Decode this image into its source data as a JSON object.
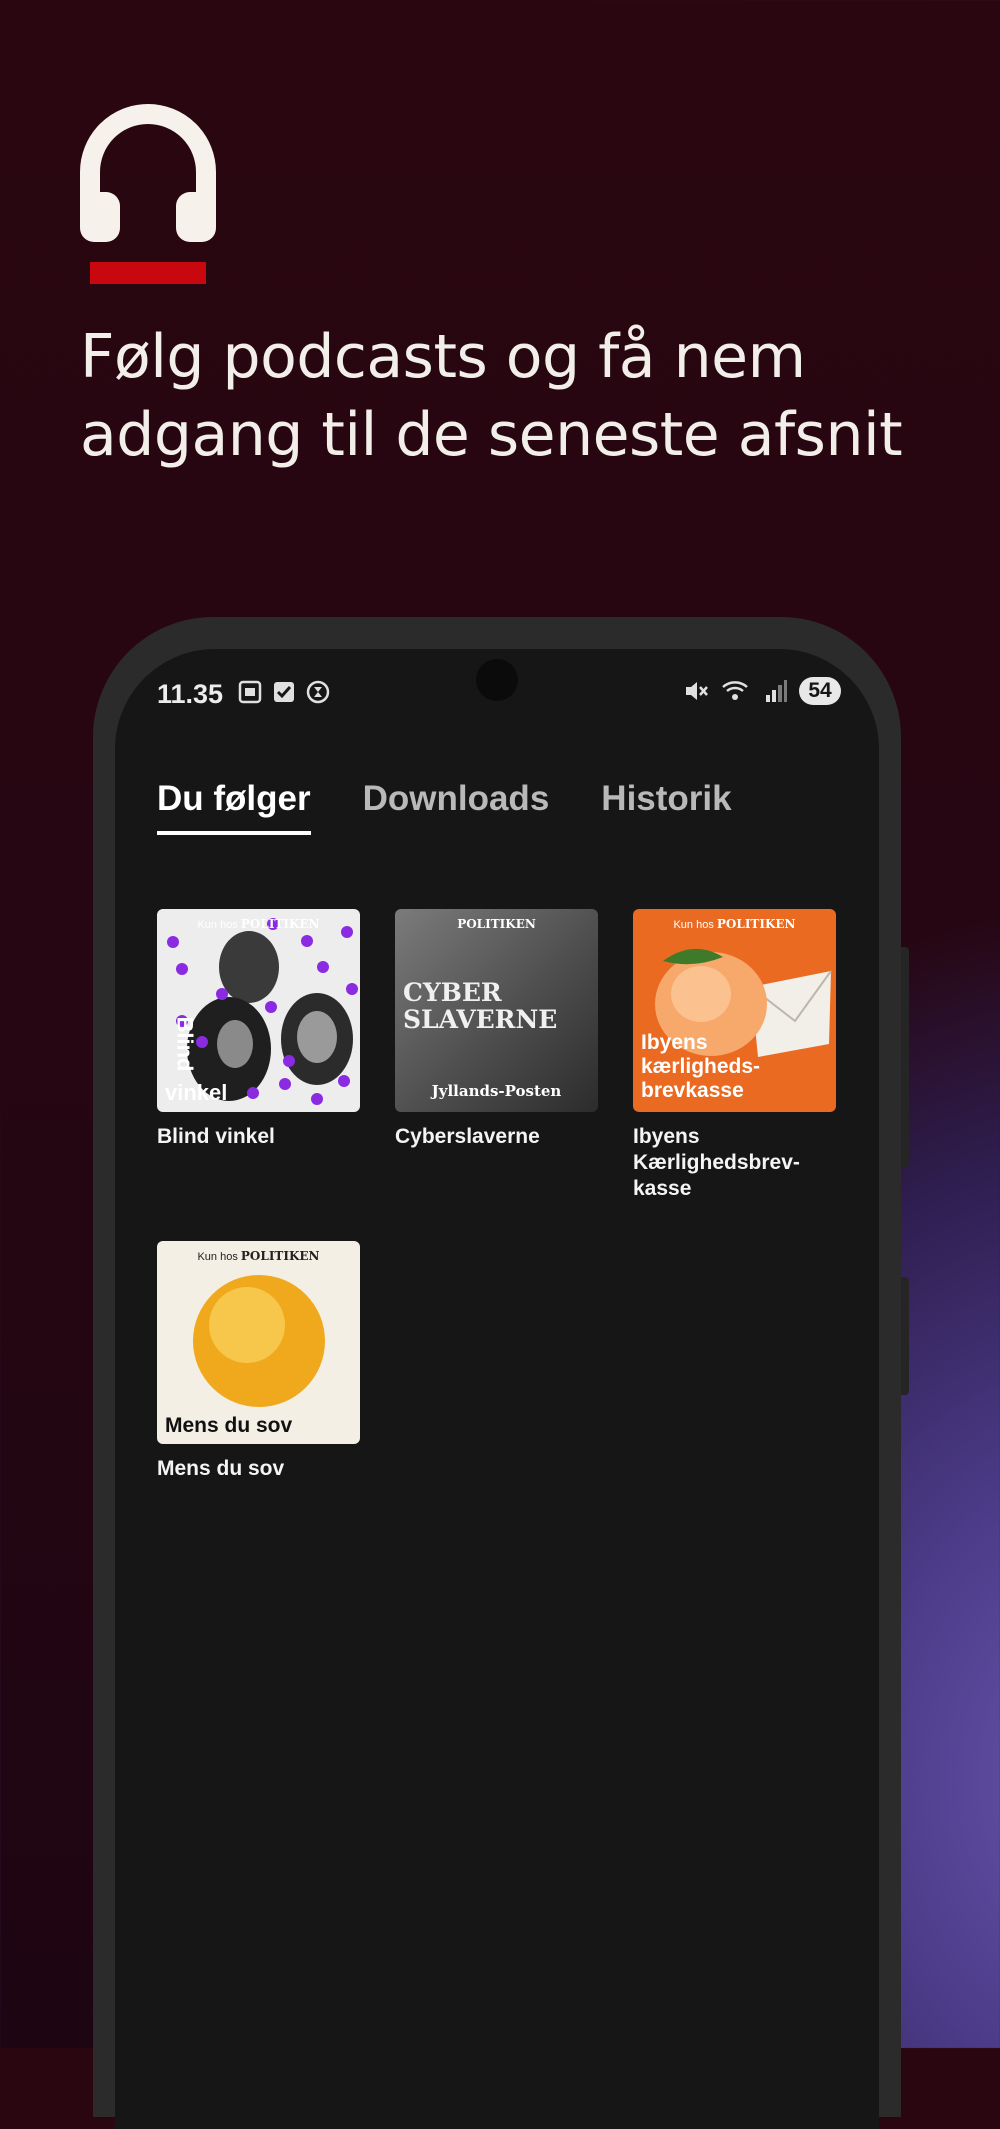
{
  "hero": {
    "title": "Følg podcasts og få nem adgang til de seneste afsnit",
    "icon": "headphones-icon",
    "accent": "#c8070f"
  },
  "status_bar": {
    "time": "11.35",
    "battery": "54"
  },
  "tabs": [
    {
      "label": "Du følger",
      "active": true
    },
    {
      "label": "Downloads",
      "active": false
    },
    {
      "label": "Historik",
      "active": false
    }
  ],
  "podcasts": [
    {
      "label": "Blind vinkel",
      "cover_text": [
        "Kun hos",
        "POLITIKEN",
        "Blind",
        "vinkel"
      ]
    },
    {
      "label": "Cyberslaverne",
      "cover_text": [
        "POLITIKEN",
        "CYBER",
        "SLAVERNE",
        "Jyllands-Posten"
      ]
    },
    {
      "label": "Ibyens Kærlighedsbrev-kasse",
      "label_lines": [
        "Ibyens",
        "Kærlighedsbrev-",
        "kasse"
      ],
      "cover_text": [
        "Kun hos",
        "POLITIKEN",
        "Ibyens",
        "kærligheds-",
        "brevkasse"
      ]
    },
    {
      "label": "Mens du sov",
      "cover_text": [
        "Kun hos",
        "POLITIKEN",
        "Mens du sov"
      ]
    }
  ]
}
